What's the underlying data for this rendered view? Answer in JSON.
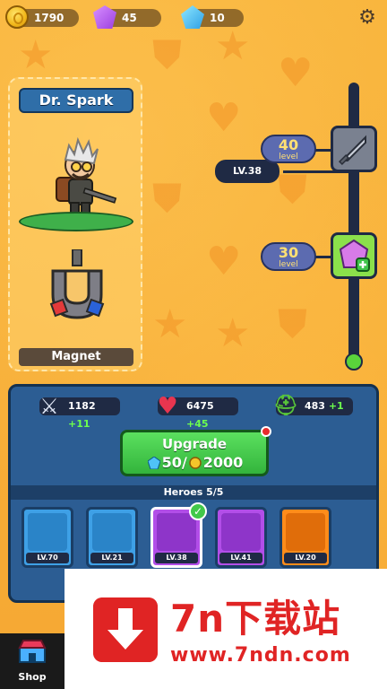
{
  "resources": {
    "coins": "1790",
    "gems": "45",
    "crystals": "10"
  },
  "icons": {
    "coin": "coin-icon",
    "gem": "gem-icon",
    "crystal": "crystal-icon",
    "settings": "gear-icon",
    "sword": "sword-icon",
    "heart": "heart-icon",
    "helmet": "helmet-icon",
    "shop": "store-icon"
  },
  "hero": {
    "name": "Dr. Spark",
    "item": "Magnet"
  },
  "level_track": {
    "current_level": "LV.38",
    "rewards": [
      {
        "level": "40",
        "unit": "level",
        "reward": "sword"
      },
      {
        "level": "30",
        "unit": "level",
        "reward": "gem"
      }
    ]
  },
  "stats": {
    "attack": "1182",
    "attack_bonus": "+11",
    "health": "6475",
    "health_bonus": "+45",
    "armor": "483",
    "armor_bonus": "+1"
  },
  "upgrade": {
    "label": "Upgrade",
    "gem_cost": "50/",
    "coin_cost": "2000"
  },
  "heroes": {
    "header": "Heroes 5/5",
    "list": [
      {
        "level": "LV.70"
      },
      {
        "level": "LV.21"
      },
      {
        "level": "LV.38",
        "selected": true
      },
      {
        "level": "LV.41"
      },
      {
        "level": "LV.20"
      }
    ]
  },
  "shop": {
    "label": "Shop"
  },
  "watermark": {
    "title": "7n下载站",
    "url": "www.7ndn.com"
  },
  "colors": {
    "background": "#f7b23a",
    "panel": "#2c5d93",
    "upgrade": "#3fc44a",
    "bonus": "#6dff4d",
    "watermark": "#e02424"
  }
}
